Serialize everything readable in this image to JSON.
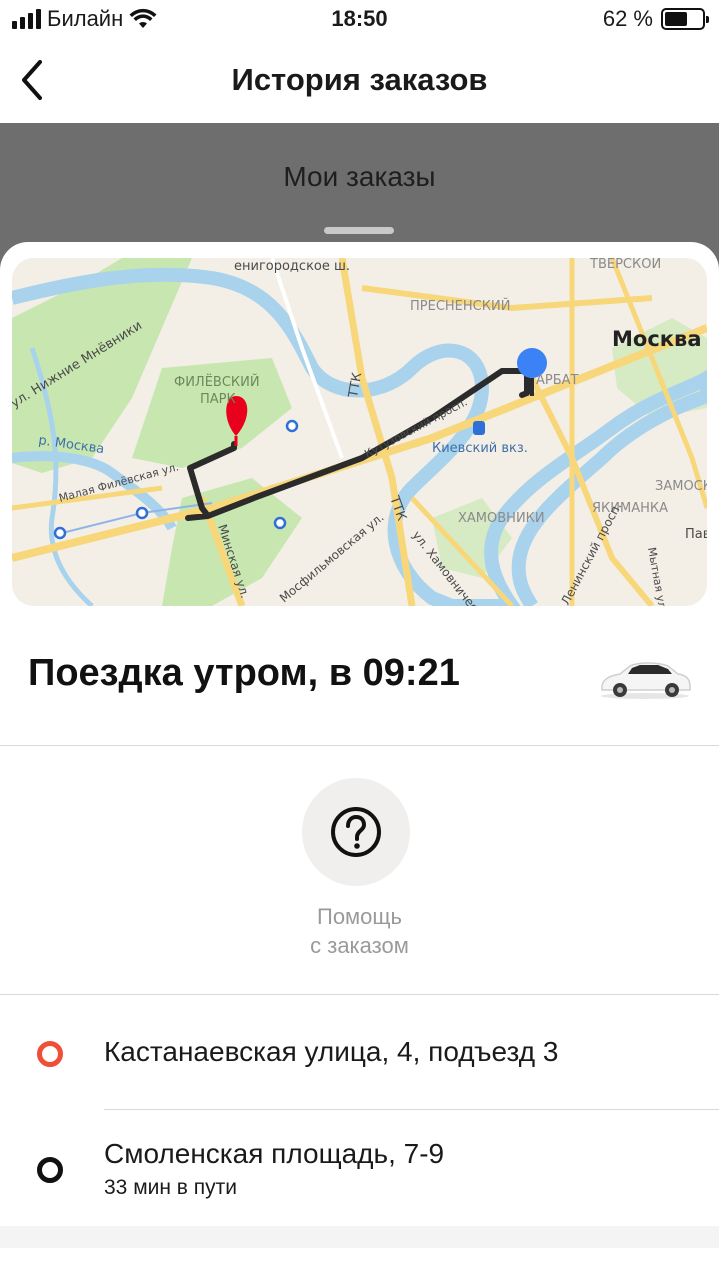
{
  "status_bar": {
    "carrier": "Билайн",
    "time": "18:50",
    "battery_text": "62 %",
    "battery_level": 0.62
  },
  "nav": {
    "back_icon": "chevron-left-icon",
    "title": "История заказов"
  },
  "backdrop": {
    "title": "Мои заказы"
  },
  "map": {
    "labels": {
      "novinsky": "енигородское ш.",
      "tverskoy": "ТВЕРСКОЙ",
      "presnensky": "ПРЕСНЕНСКИЙ",
      "moscow": "Москва",
      "ttk1": "ТТК",
      "ttk2": "ТТК",
      "nizhnie": "ул. Нижние Мнёвники",
      "filevsky": "ФИЛЁВСКИЙ",
      "park": "ПАРК",
      "arbat": "АРБАТ",
      "river": "р. Москва",
      "kievsky": "Киевский вкз.",
      "maloya": "Малая Филёвская ул.",
      "kutuz": "Кутузовский просп.",
      "khamovniki": "ХАМОВНИКИ",
      "yakimanka": "ЯКИМАНКА",
      "zamosk": "ЗАМОСК",
      "pav": "Пав",
      "minskaya": "Минская ул.",
      "mosfilm": "Мосфильмовская ул.",
      "khamov_val": "ул. Хамовнический Вал",
      "leninsky": "Ленинский просп.",
      "mytnaya": "Мытная ул."
    },
    "colors": {
      "route": "#2b2b2b",
      "pickup_pin": "#e8001c",
      "dest_pin": "#3b82f6",
      "water": "#a9d3ec",
      "park": "#c8e6b0",
      "road": "#f7d77a"
    }
  },
  "trip": {
    "title": "Поездка утром, в 09:21",
    "car_icon": "car-icon"
  },
  "help": {
    "icon": "question-icon",
    "label_line1": "Помощь",
    "label_line2": "с заказом"
  },
  "route": {
    "from": {
      "address": "Кастанаевская улица, 4, подъезд 3",
      "dot_color": "#f04e37"
    },
    "to": {
      "address": "Смоленская площадь, 7-9",
      "duration": "33 мин в пути",
      "dot_color": "#111111"
    }
  }
}
